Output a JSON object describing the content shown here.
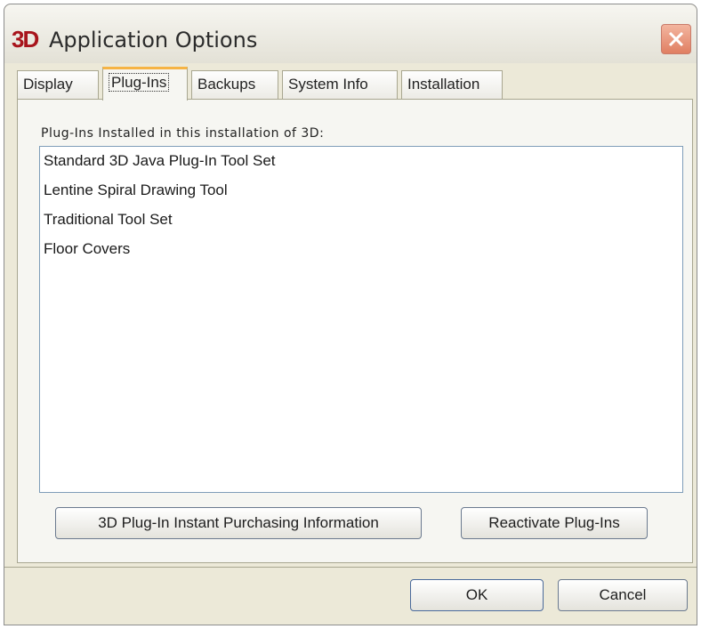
{
  "window": {
    "logo": "3D",
    "title": "Application Options"
  },
  "tabs": [
    {
      "label": "Display"
    },
    {
      "label": "Plug-Ins",
      "active": true
    },
    {
      "label": "Backups"
    },
    {
      "label": "System Info"
    },
    {
      "label": "Installation"
    }
  ],
  "plugins": {
    "heading": "Plug-Ins Installed in this installation of 3D:",
    "items": [
      "Standard 3D Java Plug-In Tool Set",
      "Lentine Spiral Drawing Tool",
      "Traditional Tool Set",
      "Floor Covers"
    ],
    "purchase_button": "3D Plug-In Instant Purchasing Information",
    "reactivate_button": "Reactivate Plug-Ins"
  },
  "footer": {
    "ok_button": "OK",
    "cancel_button": "Cancel"
  },
  "colors": {
    "accent_tab": "#f6b444",
    "close_button": "#e07f62",
    "logo_red": "#a8141c"
  }
}
